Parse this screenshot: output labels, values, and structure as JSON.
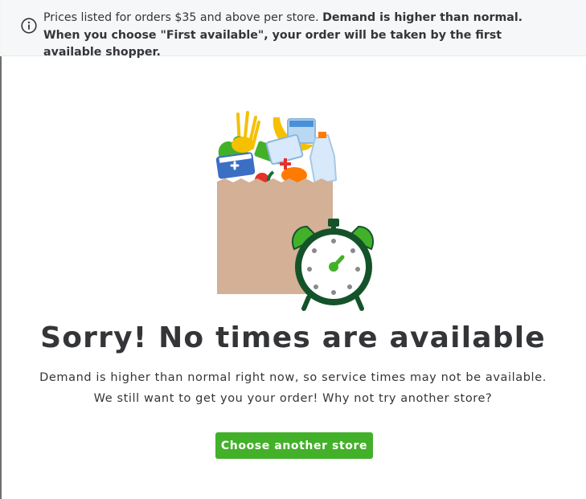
{
  "notice": {
    "icon": "info-circle-icon",
    "text_plain": "Prices listed for orders $35 and above per store. ",
    "text_bold": "Demand is higher than normal. When you choose \"First available\", your order will be taken by the first available shopper."
  },
  "illustration": {
    "icon": "grocery-bag-with-alarm-clock-icon",
    "colors": {
      "bag": "#d3b096",
      "clock_outline": "#14532a",
      "clock_bells": "#43b02a"
    }
  },
  "main": {
    "heading": "Sorry! No times are available",
    "line1": "Demand is higher than normal right now, so service times may not be available.",
    "line2": "We still want to get you your order! Why not try another store?",
    "button_label": "Choose another store"
  },
  "colors": {
    "accent": "#43b02a",
    "text": "#343538",
    "notice_bg": "#f6f7f8"
  }
}
